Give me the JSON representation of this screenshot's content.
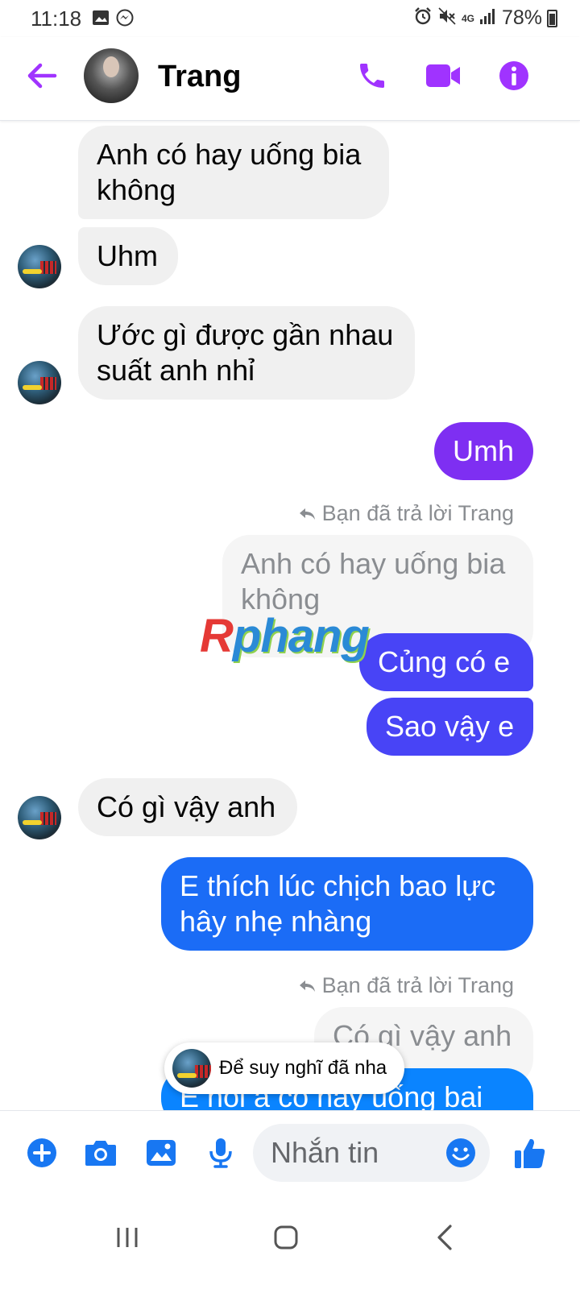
{
  "status_bar": {
    "time": "11:18",
    "battery": "78%",
    "network": "4G",
    "icons": [
      "image-icon",
      "messenger-icon",
      "alarm-icon",
      "mute-icon",
      "signal-icon",
      "battery-icon"
    ]
  },
  "header": {
    "contact_name": "Trang",
    "accent_color": "#a033ff",
    "icons": [
      "back-arrow-icon",
      "phone-icon",
      "video-camera-icon",
      "info-icon"
    ]
  },
  "messages": [
    {
      "side": "in",
      "text": "Anh có hay uống bia không"
    },
    {
      "side": "in",
      "text": "Uhm"
    },
    {
      "side": "in",
      "text": "Ước gì được gần nhau suất anh nhỉ"
    },
    {
      "side": "out",
      "text": "Umh"
    },
    {
      "side": "meta",
      "text": "Bạn đã trả lời Trang"
    },
    {
      "side": "quoted",
      "text": "Anh có hay uống bia không"
    },
    {
      "side": "out",
      "text": "Củng có e"
    },
    {
      "side": "out",
      "text": "Sao vậy e"
    },
    {
      "side": "in",
      "text": "Có gì vậy anh"
    },
    {
      "side": "out",
      "text": "E thích lúc chịch bao lực hây nhẹ nhàng"
    },
    {
      "side": "meta",
      "text": "Bạn đã trả lời Trang"
    },
    {
      "side": "quoted",
      "text": "Có gì vậy anh"
    },
    {
      "side": "out",
      "text": "E hỏi a có hay uống bai"
    }
  ],
  "watermark": {
    "first": "R",
    "rest": "phang"
  },
  "toast": {
    "text": "Để suy nghĩ đã nha"
  },
  "composer": {
    "placeholder": "Nhắn tin",
    "icons": [
      "plus-icon",
      "camera-icon",
      "gallery-icon",
      "microphone-icon",
      "emoji-icon",
      "thumbs-up-icon"
    ],
    "accent_color": "#1877f2"
  },
  "nav_bar": {
    "icons": [
      "recent-apps-icon",
      "home-icon",
      "back-icon"
    ]
  }
}
